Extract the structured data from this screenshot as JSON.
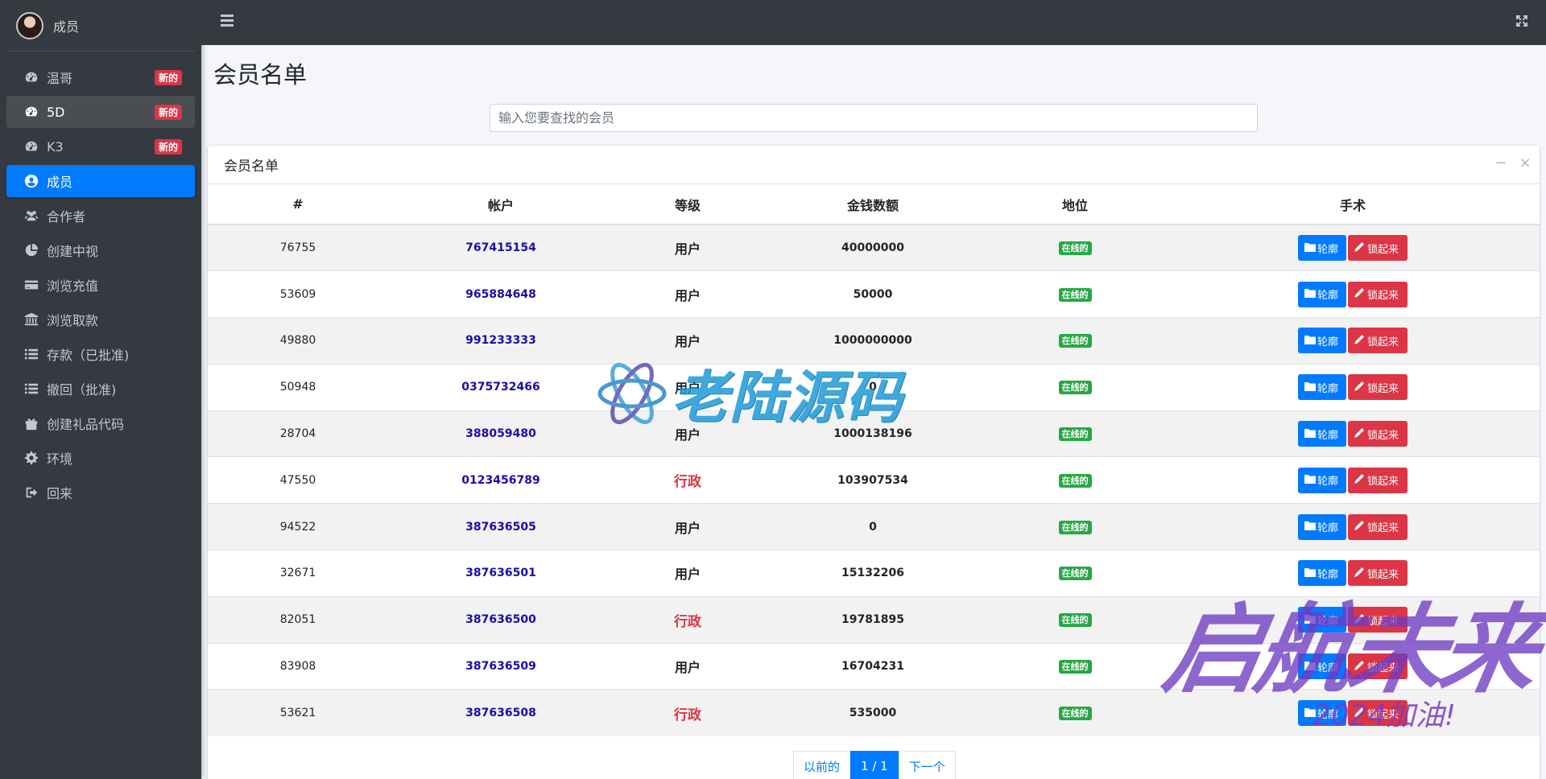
{
  "sidebar": {
    "user_name": "成员",
    "items": [
      {
        "label": "温哥",
        "icon": "tachometer-icon",
        "badge": "新的"
      },
      {
        "label": "5D",
        "icon": "tachometer-icon",
        "badge": "新的"
      },
      {
        "label": "K3",
        "icon": "tachometer-icon",
        "badge": "新的"
      },
      {
        "label": "成员",
        "icon": "user-circle-icon"
      },
      {
        "label": "合作者",
        "icon": "users-icon"
      },
      {
        "label": "创建中视",
        "icon": "pie-chart-icon"
      },
      {
        "label": "浏览充值",
        "icon": "credit-card-icon"
      },
      {
        "label": "浏览取款",
        "icon": "bank-icon"
      },
      {
        "label": "存款（已批准)",
        "icon": "list-icon"
      },
      {
        "label": "撤回（批准)",
        "icon": "list-icon"
      },
      {
        "label": "创建礼品代码",
        "icon": "gift-icon"
      },
      {
        "label": "环境",
        "icon": "gear-icon"
      },
      {
        "label": "回来",
        "icon": "sign-out-icon"
      }
    ]
  },
  "page": {
    "title": "会员名单",
    "search_placeholder": "输入您要查找的会员"
  },
  "card": {
    "title": "会员名单",
    "columns": [
      "#",
      "帐户",
      "等级",
      "金钱数额",
      "地位",
      "手术"
    ],
    "rows": [
      {
        "id": "76755",
        "account": "767415154",
        "level": "用户",
        "money": "40000000",
        "status": "在线的"
      },
      {
        "id": "53609",
        "account": "965884648",
        "level": "用户",
        "money": "50000",
        "status": "在线的"
      },
      {
        "id": "49880",
        "account": "991233333",
        "level": "用户",
        "money": "1000000000",
        "status": "在线的"
      },
      {
        "id": "50948",
        "account": "0375732466",
        "level": "用户",
        "money": "0",
        "status": "在线的"
      },
      {
        "id": "28704",
        "account": "388059480",
        "level": "用户",
        "money": "1000138196",
        "status": "在线的"
      },
      {
        "id": "47550",
        "account": "0123456789",
        "level": "行政",
        "money": "103907534",
        "status": "在线的"
      },
      {
        "id": "94522",
        "account": "387636505",
        "level": "用户",
        "money": "0",
        "status": "在线的"
      },
      {
        "id": "32671",
        "account": "387636501",
        "level": "用户",
        "money": "15132206",
        "status": "在线的"
      },
      {
        "id": "82051",
        "account": "387636500",
        "level": "行政",
        "money": "19781895",
        "status": "在线的"
      },
      {
        "id": "83908",
        "account": "387636509",
        "level": "用户",
        "money": "16704231",
        "status": "在线的"
      },
      {
        "id": "53621",
        "account": "387636508",
        "level": "行政",
        "money": "535000",
        "status": "在线的"
      }
    ],
    "btn_view": "轮廓",
    "btn_lock": "锁起来"
  },
  "pagination": {
    "prev": "以前的",
    "current": "1 / 1",
    "next": "下一个"
  },
  "watermarks": {
    "center": "老陆源码",
    "corner": "启航未来",
    "corner_sub": "2024加油!"
  },
  "colors": {
    "sidebar_bg": "#343a40",
    "active_blue": "#007bff",
    "danger_red": "#dc3545",
    "success_green": "#28a745"
  }
}
